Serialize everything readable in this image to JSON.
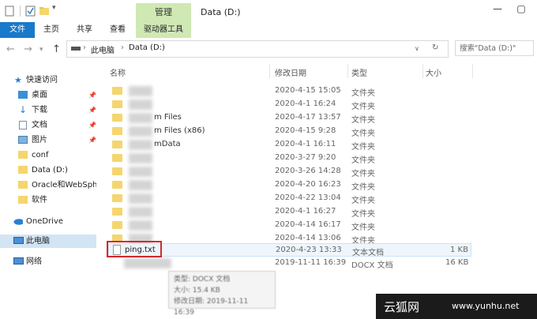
{
  "titlebar": {
    "context_tab": "管理",
    "window_title": "Data (D:)"
  },
  "ribbon": {
    "tabs": [
      "文件",
      "主页",
      "共享",
      "查看",
      "驱动器工具"
    ]
  },
  "address": {
    "crumbs": [
      "此电脑",
      "Data (D:)"
    ]
  },
  "search": {
    "placeholder": "搜索\"Data (D:)\""
  },
  "sidebar": {
    "items": [
      {
        "label": "快速访问"
      },
      {
        "label": "桌面"
      },
      {
        "label": "下载"
      },
      {
        "label": "文档"
      },
      {
        "label": "图片"
      },
      {
        "label": "conf"
      },
      {
        "label": "Data (D:)"
      },
      {
        "label": "Oracle和WebSphe"
      },
      {
        "label": "软件"
      },
      {
        "label": "OneDrive"
      },
      {
        "label": "此电脑"
      },
      {
        "label": "网络"
      }
    ]
  },
  "columns": [
    "名称",
    "修改日期",
    "类型",
    "大小"
  ],
  "rows": [
    {
      "name": "",
      "date": "2020-4-15 15:05",
      "type": "文件夹",
      "size": ""
    },
    {
      "name": "",
      "date": "2020-4-1 16:24",
      "type": "文件夹",
      "size": ""
    },
    {
      "name": "m Files",
      "date": "2020-4-17 13:57",
      "type": "文件夹",
      "size": ""
    },
    {
      "name": "m Files (x86)",
      "date": "2020-4-15 9:28",
      "type": "文件夹",
      "size": ""
    },
    {
      "name": "mData",
      "date": "2020-4-1 16:11",
      "type": "文件夹",
      "size": ""
    },
    {
      "name": "",
      "date": "2020-3-27 9:20",
      "type": "文件夹",
      "size": ""
    },
    {
      "name": "",
      "date": "2020-3-26 14:28",
      "type": "文件夹",
      "size": ""
    },
    {
      "name": "",
      "date": "2020-4-20 16:23",
      "type": "文件夹",
      "size": ""
    },
    {
      "name": "",
      "date": "2020-4-22 13:04",
      "type": "文件夹",
      "size": ""
    },
    {
      "name": "",
      "date": "2020-4-1 16:27",
      "type": "文件夹",
      "size": ""
    },
    {
      "name": "",
      "date": "2020-4-14 16:17",
      "type": "文件夹",
      "size": ""
    },
    {
      "name": "",
      "date": "2020-4-14 13:06",
      "type": "文件夹",
      "size": ""
    },
    {
      "name": "ping.txt",
      "date": "2020-4-23 13:33",
      "type": "文本文档",
      "size": "1 KB"
    },
    {
      "name": "",
      "date": "2019-11-11 16:39",
      "type": "DOCX 文档",
      "size": "16 KB"
    }
  ],
  "tooltip": {
    "lines": [
      "类型: DOCX 文档",
      "大小: 15.4 KB",
      "修改日期: 2019-11-11 16:39"
    ]
  },
  "watermark": {
    "brand": "云狐网",
    "url": "www.yunhu.net"
  },
  "colors": {
    "file_tab": "#1979ca",
    "context_tab": "#cfe8b4",
    "selected": "#d3e4f4",
    "highlight_box": "#d7262e"
  }
}
